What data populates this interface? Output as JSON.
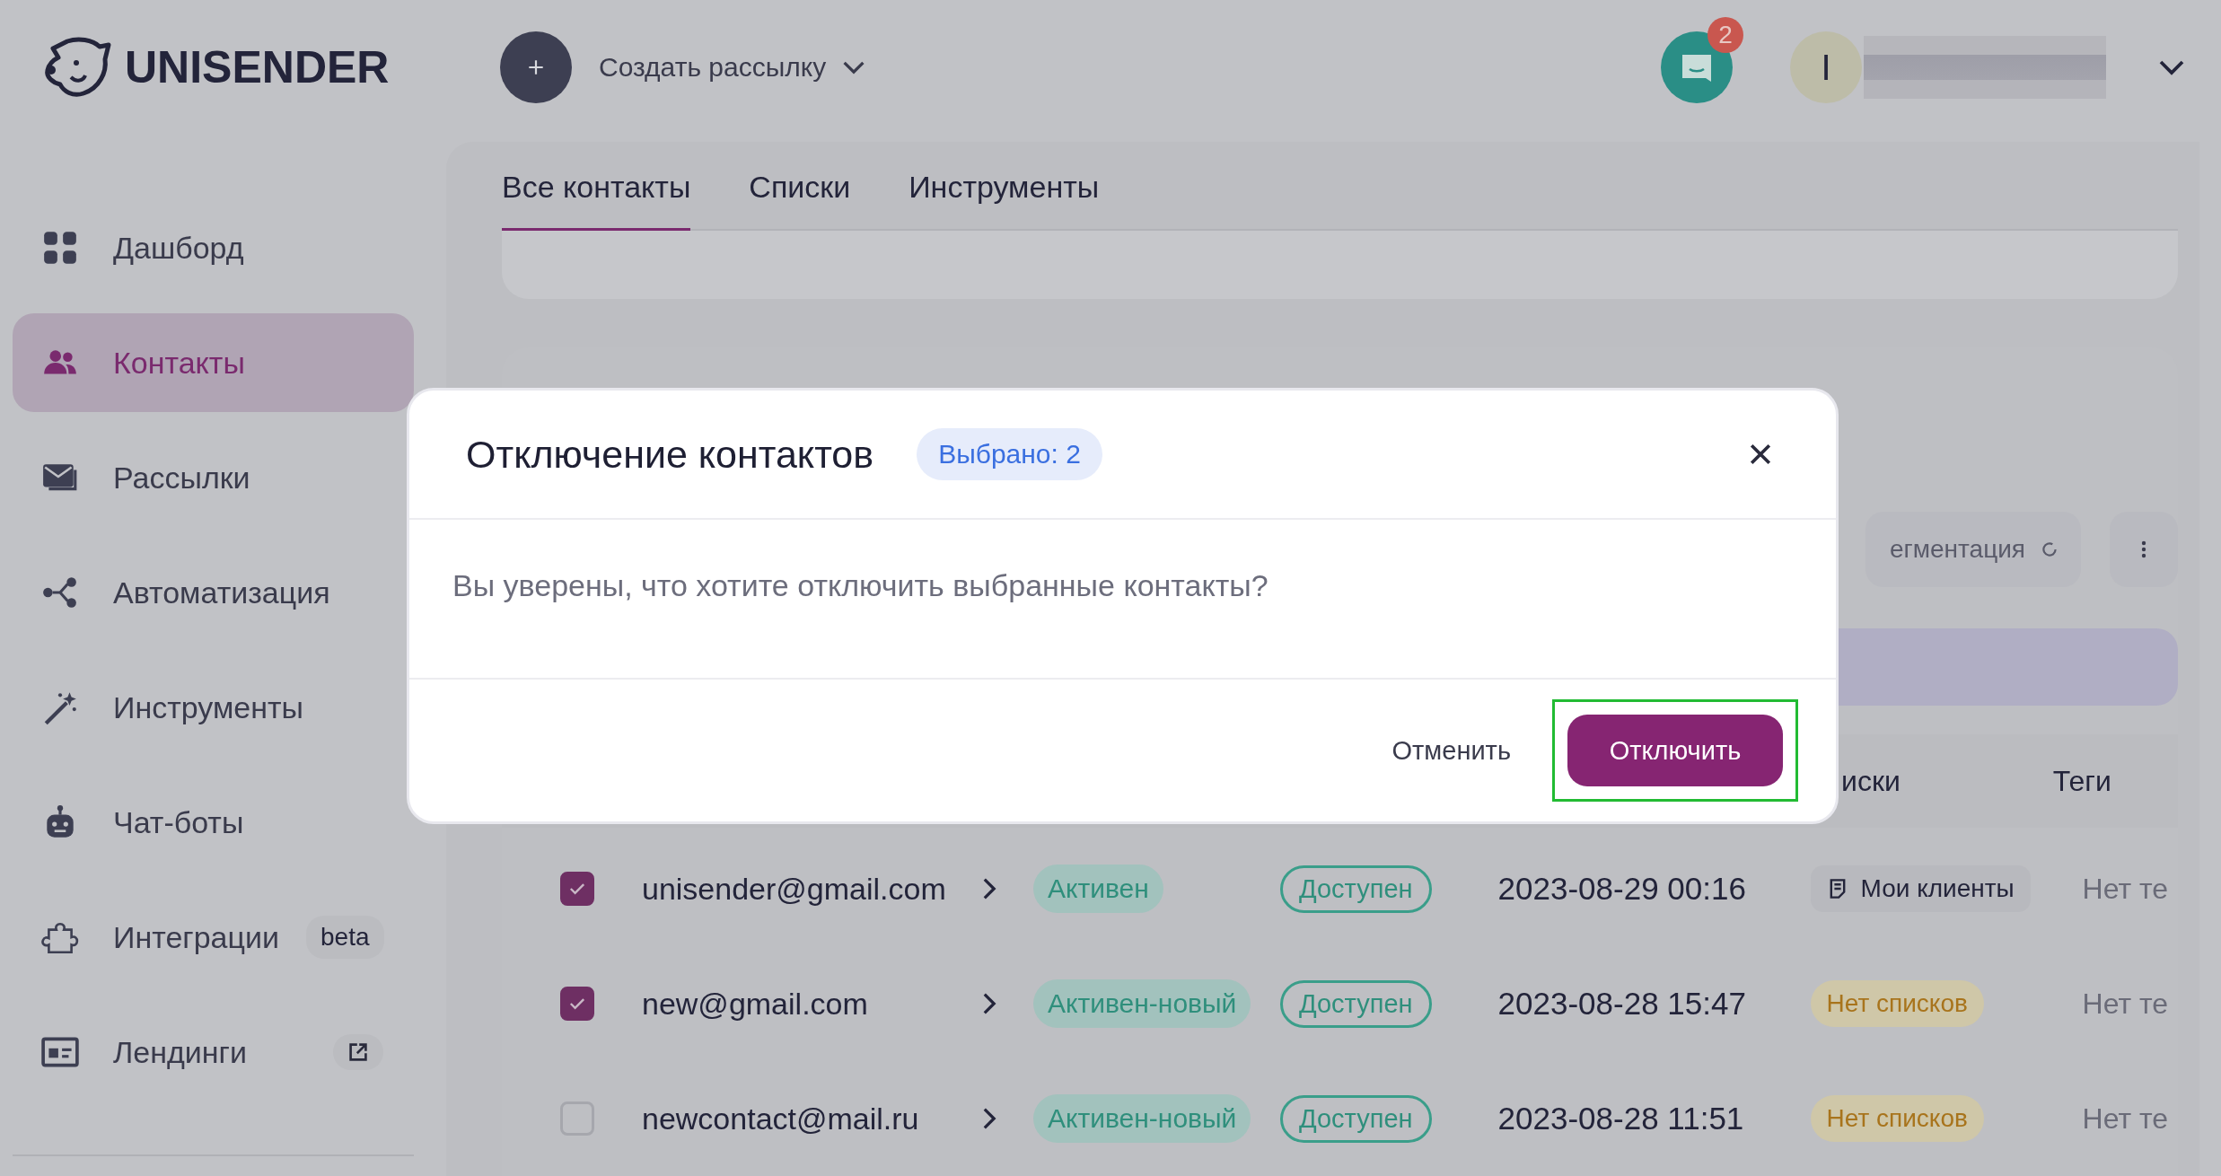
{
  "header": {
    "logo_text": "UNISENDER",
    "create_label": "Создать рассылку",
    "notifications": "2",
    "avatar_initial": "I"
  },
  "sidebar": {
    "items": [
      {
        "label": "Дашборд",
        "kind": "dashboard",
        "selected": false
      },
      {
        "label": "Контакты",
        "kind": "contacts",
        "selected": true
      },
      {
        "label": "Рассылки",
        "kind": "mail",
        "selected": false
      },
      {
        "label": "Автоматизация",
        "kind": "automation",
        "selected": false
      },
      {
        "label": "Инструменты",
        "kind": "tools",
        "selected": false
      },
      {
        "label": "Чат-боты",
        "kind": "bot",
        "selected": false
      },
      {
        "label": "Интеграции",
        "kind": "puzzle",
        "selected": false,
        "badge": "beta"
      },
      {
        "label": "Лендинги",
        "kind": "landing",
        "selected": false,
        "external": true
      }
    ]
  },
  "tabs": [
    {
      "label": "Все контакты",
      "selected": true
    },
    {
      "label": "Списки",
      "selected": false
    },
    {
      "label": "Инструменты",
      "selected": false
    }
  ],
  "toolbar": {
    "segmentation_label": "егментация"
  },
  "table": {
    "columns": [
      "иски",
      "Теги"
    ],
    "rows": [
      {
        "checked": true,
        "email": "unisender@gmail.com",
        "status": "Активен",
        "availability": "Доступен",
        "date": "2023-08-29 00:16",
        "lists": {
          "kind": "list",
          "label": "Мои клиенты"
        },
        "tags": "Нет те"
      },
      {
        "checked": true,
        "email": "new@gmail.com",
        "status": "Активен-новый",
        "availability": "Доступен",
        "date": "2023-08-28 15:47",
        "lists": {
          "kind": "none",
          "label": "Нет списков"
        },
        "tags": "Нет те"
      },
      {
        "checked": false,
        "email": "newcontact@mail.ru",
        "status": "Активен-новый",
        "availability": "Доступен",
        "date": "2023-08-28 11:51",
        "lists": {
          "kind": "none",
          "label": "Нет списков"
        },
        "tags": "Нет те"
      }
    ]
  },
  "modal": {
    "title": "Отключение контактов",
    "badge": "Выбрано: 2",
    "message": "Вы уверены, что хотите отключить выбранные контакты?",
    "cancel": "Отменить",
    "confirm": "Отключить",
    "confirm_highlighted": true
  }
}
